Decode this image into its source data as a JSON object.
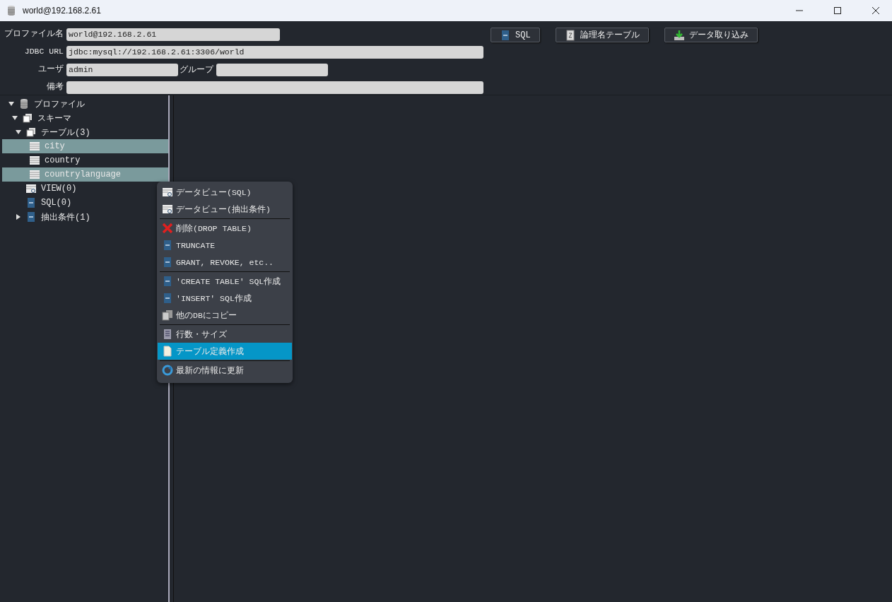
{
  "window": {
    "title": "world@192.168.2.61"
  },
  "form": {
    "profile_label": "プロファイル名",
    "profile_value": "world@192.168.2.61",
    "jdbc_label": "JDBC URL",
    "jdbc_value": "jdbc:mysql://192.168.2.61:3306/world",
    "user_label": "ユーザ",
    "user_value": "admin",
    "group_label": "グループ",
    "note_label": "備考"
  },
  "buttons": [
    {
      "label": "SQL",
      "kind": "sql"
    },
    {
      "label": "論理名テーブル",
      "kind": "logical"
    },
    {
      "label": "データ取り込み",
      "kind": "import"
    }
  ],
  "tree": [
    {
      "label": "プロファイル",
      "kind": "database",
      "expanded": true,
      "selected": false,
      "children": [
        {
          "label": "スキーマ",
          "kind": "schema",
          "expanded": true,
          "selected": false,
          "children": [
            {
              "label": "テーブル(3)",
              "kind": "schema",
              "expanded": true,
              "selected": false,
              "children": [
                {
                  "label": "city",
                  "kind": "table",
                  "selected": true
                },
                {
                  "label": "country",
                  "kind": "table",
                  "selected": false
                },
                {
                  "label": "countrylanguage",
                  "kind": "table",
                  "selected": true
                }
              ]
            },
            {
              "label": "VIEW(0)",
              "kind": "view",
              "selected": false
            },
            {
              "label": "SQL(0)",
              "kind": "sql",
              "selected": false
            },
            {
              "label": "抽出条件(1)",
              "kind": "sql",
              "expanded": false,
              "selected": false
            }
          ]
        }
      ]
    }
  ],
  "context_menu": [
    {
      "kind": "view",
      "label": "データビュー(SQL)",
      "selected": false
    },
    {
      "kind": "view",
      "label": "データビュー(抽出条件)",
      "selected": false
    },
    {
      "kind": "separator"
    },
    {
      "kind": "delete",
      "label": "削除(DROP TABLE)",
      "selected": false
    },
    {
      "kind": "sql",
      "label": "TRUNCATE",
      "selected": false
    },
    {
      "kind": "sql",
      "label": "GRANT, REVOKE, etc..",
      "selected": false
    },
    {
      "kind": "separator"
    },
    {
      "kind": "sql",
      "label": "'CREATE TABLE' SQL作成",
      "selected": false
    },
    {
      "kind": "sql",
      "label": "'INSERT' SQL作成",
      "selected": false
    },
    {
      "kind": "copy",
      "label": "他のDBにコピー",
      "selected": false
    },
    {
      "kind": "separator"
    },
    {
      "kind": "rows",
      "label": "行数・サイズ",
      "selected": false
    },
    {
      "kind": "doc",
      "label": "テーブル定義作成",
      "selected": true
    },
    {
      "kind": "separator"
    },
    {
      "kind": "refresh",
      "label": "最新の情報に更新",
      "selected": false
    }
  ]
}
